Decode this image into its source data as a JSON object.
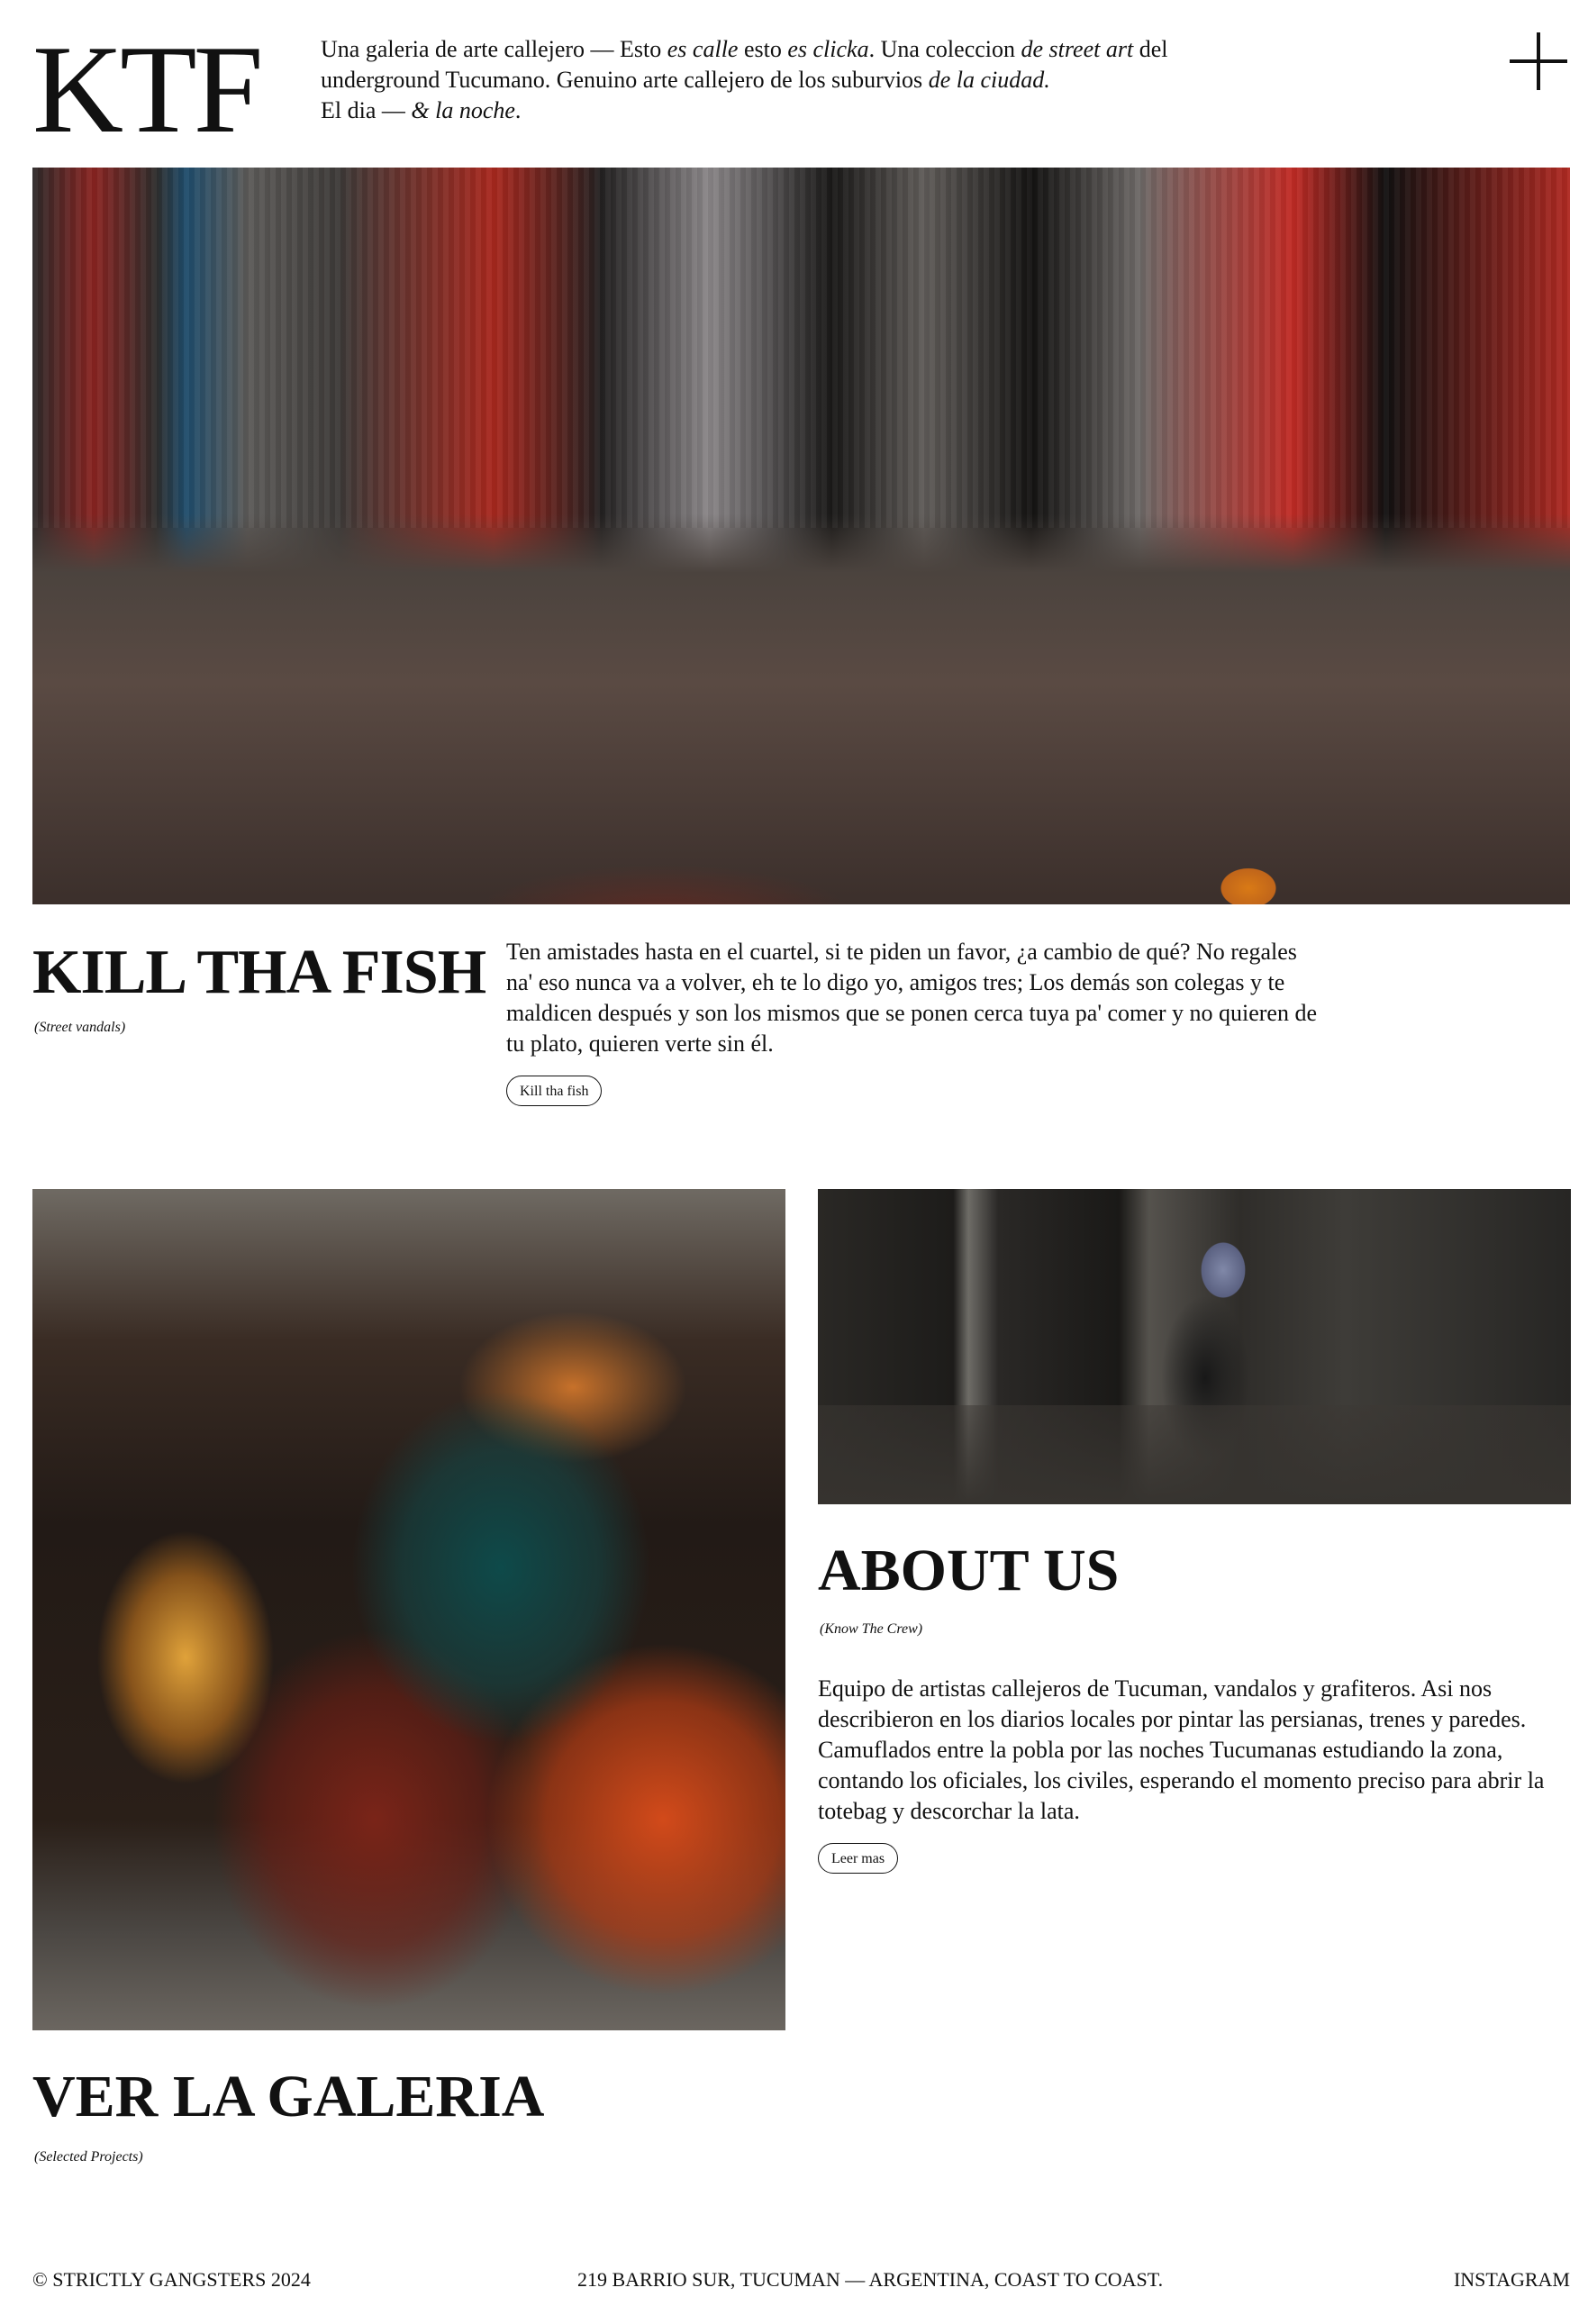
{
  "header": {
    "logo": "KTF",
    "intro": {
      "t1": "Una galeria de arte callejero — Esto ",
      "i1": "es calle",
      "t2": " esto ",
      "i2": "es clicka",
      "t3": ". Una coleccion ",
      "i3": "de street art",
      "t4": " del underground Tucumano. Genuino arte callejero de los suburvios ",
      "i4": "de la ciudad.",
      "t5": " El dia — ",
      "i5": "& la noche",
      "t6": "."
    },
    "menu_icon": "plus-icon"
  },
  "hero": {
    "title": "KILL THA FISH",
    "subtitle": "(Street vandals)",
    "text": "Ten amistades hasta en el cuartel, si te piden un favor, ¿a cambio de qué? No regales na' eso nunca va a volver, eh te lo digo yo, amigos tres; Los demás son colegas y te maldicen después y son los mismos que se ponen cerca tuya pa' comer y no quieren de tu plato, quieren verte sin él.",
    "button_label": "Kill tha fish"
  },
  "about": {
    "title": "ABOUT US",
    "subtitle": "(Know The Crew)",
    "text": "Equipo de artistas callejeros de Tucuman, vandalos y grafiteros. Asi nos describieron en los diarios locales por pintar las persianas, trenes y paredes. Camuflados entre la pobla por las noches Tucumanas estudiando la zona, contando los oficiales, los civiles, esperando el momento preciso para abrir la totebag y descorchar la lata.",
    "button_label": "Leer mas"
  },
  "gallery": {
    "title": "VER LA GALERIA",
    "subtitle": "(Selected Projects)"
  },
  "footer": {
    "copyright": "© STRICTLY GANGSTERS 2024",
    "address": "219 BARRIO SUR, TUCUMAN — ARGENTINA, COAST TO COAST.",
    "instagram": "INSTAGRAM"
  }
}
